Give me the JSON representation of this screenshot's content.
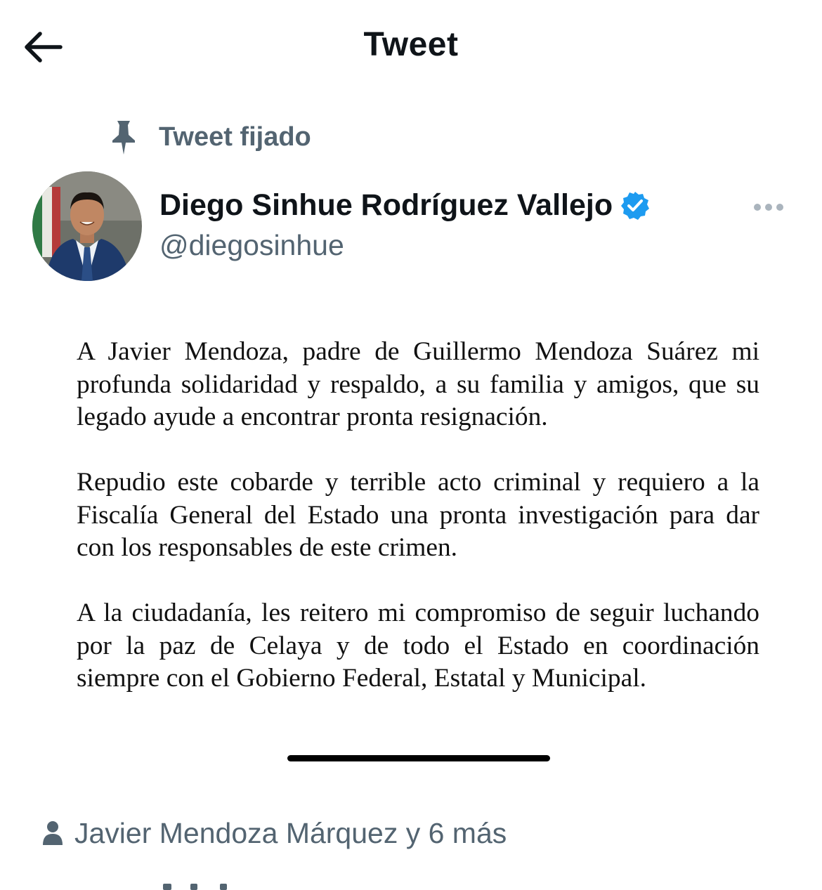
{
  "header": {
    "title": "Tweet",
    "back_icon": "arrow-left-icon"
  },
  "pinned": {
    "label": "Tweet fijado",
    "icon": "pin-icon"
  },
  "author": {
    "name": "Diego Sinhue Rodríguez Vallejo",
    "handle": "@diegosinhue",
    "verified": true,
    "verified_color": "#1d9bf0"
  },
  "tweet": {
    "paragraphs": [
      "A Javier Mendoza, padre de Guillermo Mendoza Suárez mi profunda solidaridad y respaldo, a su familia y amigos, que su legado ayude a encontrar pronta resignación.",
      "Repudio este cobarde y terrible acto criminal y requiero a la Fiscalía General del Estado una pronta investigación para dar con los responsables de este crimen.",
      "A la ciudadanía, les reitero mi compromiso de seguir luchando por la paz de Celaya y de todo el Estado en coordinación siempre con el Gobierno Federal, Estatal y Municipal."
    ]
  },
  "social_context": {
    "text": "Javier Mendoza Márquez y 6 más",
    "icon": "person-icon"
  },
  "colors": {
    "text_primary": "#0f1419",
    "text_secondary": "#536471",
    "accent": "#1d9bf0"
  }
}
